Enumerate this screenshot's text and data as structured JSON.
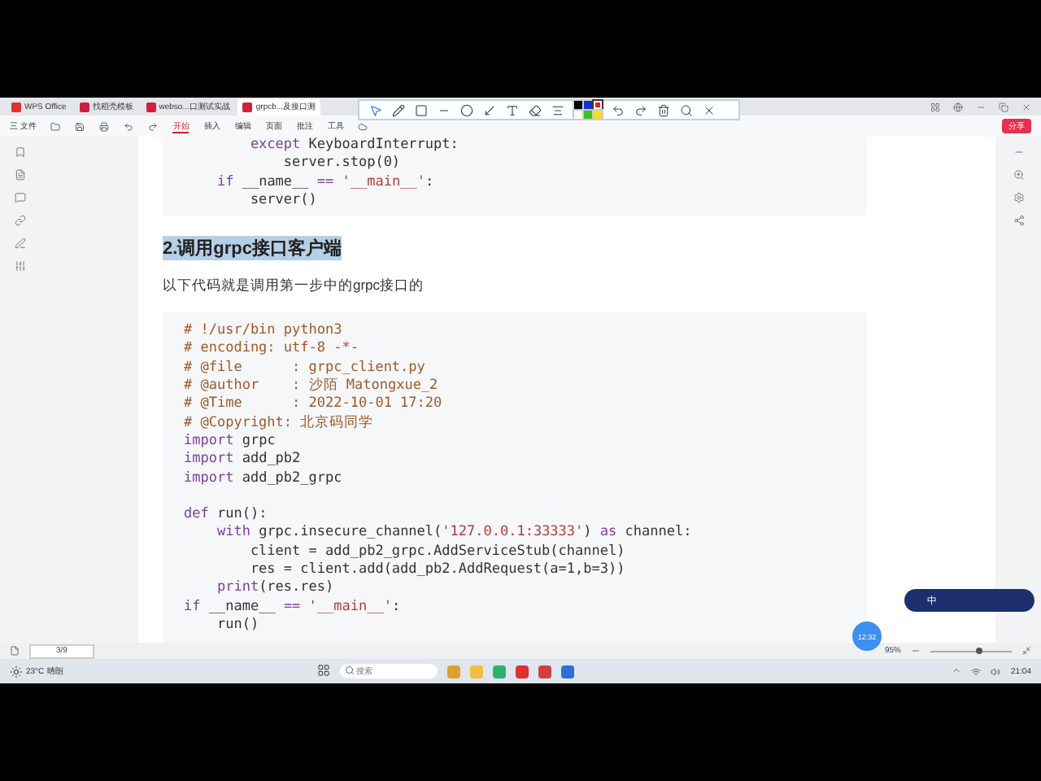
{
  "tabs": [
    {
      "label": "WPS Office",
      "selected": false,
      "kind": "home"
    },
    {
      "label": "找稻壳模板",
      "selected": false,
      "kind": "doc"
    },
    {
      "label": "webso...口测试实战",
      "selected": false,
      "kind": "doc"
    },
    {
      "label": "grpcb...及接口测",
      "selected": true,
      "kind": "doc"
    }
  ],
  "ribbon": {
    "file_menu": "三 文件",
    "items": [
      {
        "label": "开始",
        "selected": true
      },
      {
        "label": "插入",
        "selected": false
      },
      {
        "label": "编辑",
        "selected": false
      },
      {
        "label": "页面",
        "selected": false
      },
      {
        "label": "批注",
        "selected": false
      },
      {
        "label": "工具",
        "selected": false
      }
    ],
    "share_button": "分享"
  },
  "annotation_toolbar": {
    "tools": [
      {
        "kind": "pointer",
        "selected": true
      },
      {
        "kind": "pen",
        "selected": false
      },
      {
        "kind": "rectangle",
        "selected": false
      },
      {
        "kind": "line",
        "selected": false
      },
      {
        "kind": "ellipse",
        "selected": false
      },
      {
        "kind": "arrow",
        "selected": false
      },
      {
        "kind": "text",
        "selected": false
      },
      {
        "kind": "eraser",
        "selected": false
      },
      {
        "kind": "lines",
        "selected": false
      }
    ],
    "palette": [
      {
        "color": "#000000",
        "selected": false
      },
      {
        "color": "#1030d0",
        "selected": false
      },
      {
        "color": "#e02020",
        "selected": true
      },
      {
        "color": "#ffffff",
        "selected": false
      },
      {
        "color": "#40c020",
        "selected": false
      },
      {
        "color": "#f0e020",
        "selected": false
      }
    ]
  },
  "document": {
    "blocks": [
      {
        "kind": "code",
        "lines": [
          {
            "tokens": [
              {
                "text": "        except",
                "kind": "keyword"
              },
              {
                "text": " KeyboardInterrupt:",
                "kind": "plain"
              }
            ]
          },
          {
            "tokens": [
              {
                "text": "            server.stop(0)",
                "kind": "plain"
              }
            ]
          },
          {
            "tokens": [
              {
                "text": "    if",
                "kind": "keyword"
              },
              {
                "text": " __name__ ",
                "kind": "plain"
              },
              {
                "text": "==",
                "kind": "keyword"
              },
              {
                "text": " '__main__'",
                "kind": "string"
              },
              {
                "text": ":",
                "kind": "plain"
              }
            ]
          },
          {
            "tokens": [
              {
                "text": "        server()",
                "kind": "plain"
              }
            ]
          }
        ]
      },
      {
        "kind": "heading",
        "text": "2.调用grpc接口客户端",
        "highlighted": true
      },
      {
        "kind": "paragraph",
        "text": "以下代码就是调用第一步中的grpc接口的"
      },
      {
        "kind": "code",
        "lines": [
          {
            "tokens": [
              {
                "text": "# !/usr/bin python3",
                "kind": "comment"
              }
            ]
          },
          {
            "tokens": [
              {
                "text": "# encoding: utf-8 -*-",
                "kind": "comment"
              }
            ]
          },
          {
            "tokens": [
              {
                "text": "# @file      : grpc_client.py",
                "kind": "comment"
              }
            ]
          },
          {
            "tokens": [
              {
                "text": "# @author    : 沙陌 Matongxue_2",
                "kind": "comment"
              }
            ]
          },
          {
            "tokens": [
              {
                "text": "# @Time      : 2022-10-01 17:20",
                "kind": "comment"
              }
            ]
          },
          {
            "tokens": [
              {
                "text": "# @Copyright: 北京码同学",
                "kind": "comment"
              }
            ]
          },
          {
            "tokens": [
              {
                "text": "import",
                "kind": "keyword"
              },
              {
                "text": " grpc",
                "kind": "plain"
              }
            ]
          },
          {
            "tokens": [
              {
                "text": "import",
                "kind": "keyword"
              },
              {
                "text": " add_pb2",
                "kind": "plain"
              }
            ]
          },
          {
            "tokens": [
              {
                "text": "import",
                "kind": "keyword"
              },
              {
                "text": " add_pb2_grpc",
                "kind": "plain"
              }
            ]
          },
          {
            "gap_before": true,
            "tokens": [
              {
                "text": "def",
                "kind": "keyword"
              },
              {
                "text": " run():",
                "kind": "plain"
              }
            ]
          },
          {
            "tokens": [
              {
                "text": "    with",
                "kind": "keyword"
              },
              {
                "text": " grpc.insecure_channel(",
                "kind": "plain"
              },
              {
                "text": "'127.0.0.1:33333'",
                "kind": "string"
              },
              {
                "text": ") ",
                "kind": "plain"
              },
              {
                "text": "as",
                "kind": "keyword"
              },
              {
                "text": " channel:",
                "kind": "plain"
              }
            ]
          },
          {
            "tokens": [
              {
                "text": "        client = add_pb2_grpc.AddServiceStub(channel)",
                "kind": "plain"
              }
            ]
          },
          {
            "tokens": [
              {
                "text": "        res = client.add(add_pb2.AddRequest(a=1,b=3))",
                "kind": "plain"
              }
            ]
          },
          {
            "tokens": [
              {
                "text": "    print",
                "kind": "keyword"
              },
              {
                "text": "(res.res)",
                "kind": "plain"
              }
            ]
          },
          {
            "tokens": [
              {
                "text": "if",
                "kind": "keyword"
              },
              {
                "text": " __name__ ",
                "kind": "plain"
              },
              {
                "text": "==",
                "kind": "keyword"
              },
              {
                "text": " '__main__'",
                "kind": "string"
              },
              {
                "text": ":",
                "kind": "plain"
              }
            ]
          },
          {
            "tokens": [
              {
                "text": "    run()",
                "kind": "plain"
              }
            ]
          }
        ]
      }
    ]
  },
  "time_badge": "12:32",
  "ime_widget": {
    "label": "中"
  },
  "status_bar": {
    "page": "3/9",
    "zoom": "95%",
    "zoom_level": {
      "level": 0.6
    }
  },
  "taskbar": {
    "temperature": "23°C",
    "weather": "晴朗",
    "search": {
      "placeholder": "搜索"
    },
    "time": "21:04"
  }
}
